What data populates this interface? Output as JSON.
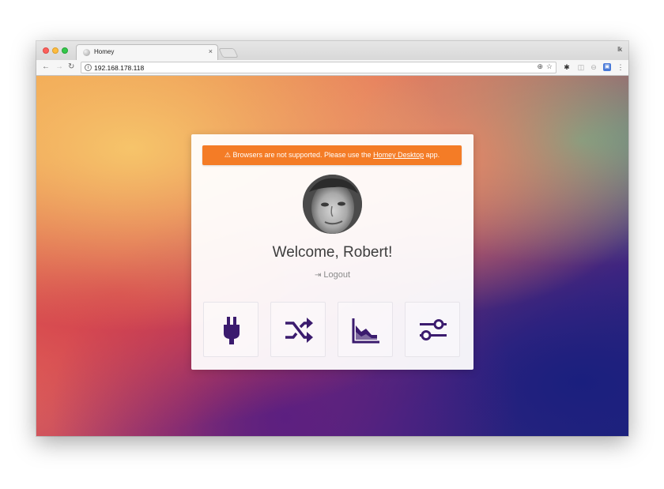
{
  "browser": {
    "tab_title": "Homey",
    "tab_close": "×",
    "profile": "lk",
    "url": "192.168.178.118",
    "icons": [
      "back-icon",
      "forward-icon",
      "reload-icon",
      "info-icon",
      "zoom-icon",
      "star-icon",
      "gear-icon",
      "menu-icon"
    ]
  },
  "alert": {
    "icon": "⚠",
    "text_before": "Browsers are not supported. Please use the ",
    "link": "Homey Desktop",
    "text_after": " app.",
    "color": "#f47c26"
  },
  "user": {
    "welcome": "Welcome, Robert!",
    "logout": "Logout"
  },
  "tiles": [
    {
      "icon": "plug-icon",
      "label": "Devices"
    },
    {
      "icon": "flow-icon",
      "label": "Flows"
    },
    {
      "icon": "insights-icon",
      "label": "Insights"
    },
    {
      "icon": "settings-sliders-icon",
      "label": "Settings"
    }
  ],
  "colors": {
    "icon_accent": "#3b1b6e"
  }
}
